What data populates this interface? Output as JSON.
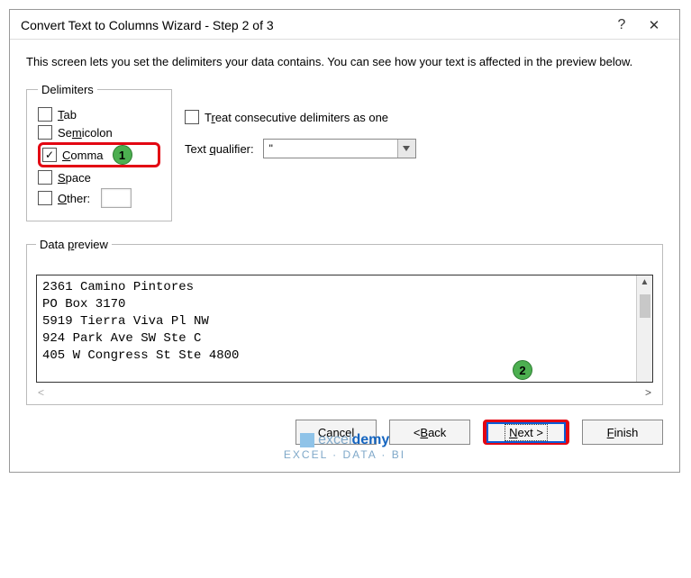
{
  "title": "Convert Text to Columns Wizard - Step 2 of 3",
  "description": "This screen lets you set the delimiters your data contains.  You can see how your text is affected in the preview below.",
  "delimiters": {
    "legend": "Delimiters",
    "tab": {
      "label": "Tab",
      "checked": false
    },
    "semicolon": {
      "label": "Semicolon",
      "checked": false
    },
    "comma": {
      "label": "Comma",
      "checked": true
    },
    "space": {
      "label": "Space",
      "checked": false
    },
    "other": {
      "label": "Other:",
      "checked": false,
      "value": ""
    }
  },
  "consecutive": {
    "label": "Treat consecutive delimiters as one",
    "checked": false
  },
  "qualifier": {
    "label": "Text qualifier:",
    "value": "\""
  },
  "preview": {
    "legend": "Data preview",
    "lines": "2361 Camino Pintores\nPO Box 3170\n5919 Tierra Viva Pl NW\n924 Park Ave SW Ste C\n405 W Congress St Ste 4800"
  },
  "buttons": {
    "cancel": "Cancel",
    "back": "< Back",
    "next": "Next >",
    "finish": "Finish"
  },
  "callouts": {
    "one": "1",
    "two": "2"
  },
  "watermark": {
    "brand_a": "excel",
    "brand_b": "demy",
    "sub": "EXCEL · DATA · BI"
  }
}
